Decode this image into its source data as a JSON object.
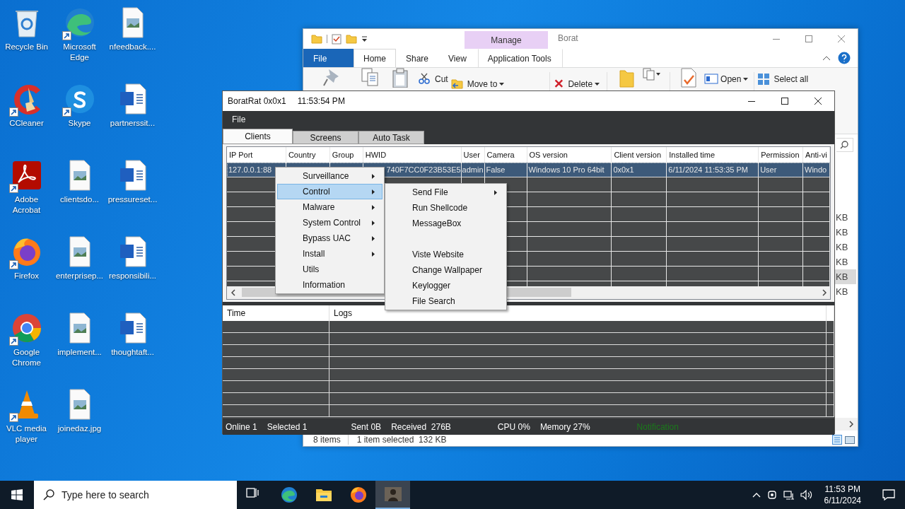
{
  "desktop": {
    "icons": [
      {
        "label": "Recycle Bin",
        "kind": "recycle",
        "shortcut": false
      },
      {
        "label": "CCleaner",
        "kind": "ccleaner",
        "shortcut": true
      },
      {
        "label": "Adobe Acrobat",
        "kind": "acrobat",
        "shortcut": true
      },
      {
        "label": "Firefox",
        "kind": "firefox",
        "shortcut": true
      },
      {
        "label": "Google Chrome",
        "kind": "chrome",
        "shortcut": true
      },
      {
        "label": "VLC media player",
        "kind": "vlc",
        "shortcut": true
      },
      {
        "label": "Microsoft Edge",
        "kind": "edge",
        "shortcut": true
      },
      {
        "label": "Skype",
        "kind": "skype",
        "shortcut": true
      },
      {
        "label": "clientsdo...",
        "kind": "image",
        "shortcut": false
      },
      {
        "label": "enterprisep...",
        "kind": "image",
        "shortcut": false
      },
      {
        "label": "implement...",
        "kind": "image",
        "shortcut": false
      },
      {
        "label": "joinedaz.jpg",
        "kind": "image",
        "shortcut": false
      },
      {
        "label": "nfeedback....",
        "kind": "image",
        "shortcut": false
      },
      {
        "label": "partnerssit...",
        "kind": "word",
        "shortcut": false
      },
      {
        "label": "pressureset...",
        "kind": "word",
        "shortcut": false
      },
      {
        "label": "responsibili...",
        "kind": "word",
        "shortcut": false
      },
      {
        "label": "thoughtaft...",
        "kind": "word",
        "shortcut": false
      }
    ]
  },
  "explorer": {
    "title": "Borat",
    "contextual_tab_group": "Manage",
    "tabs": [
      {
        "label": "File",
        "kind": "backstage",
        "selected": false
      },
      {
        "label": "Home",
        "kind": "tab",
        "selected": true
      },
      {
        "label": "Share",
        "kind": "tab",
        "selected": false
      },
      {
        "label": "View",
        "kind": "tab",
        "selected": false
      },
      {
        "label": "Application Tools",
        "kind": "contextual",
        "selected": false
      }
    ],
    "ribbon": [
      {
        "label": "Cut",
        "kind": "cut"
      },
      {
        "label": "Move to",
        "kind": "move"
      },
      {
        "label": "Delete",
        "kind": "delete"
      },
      {
        "label": "Open",
        "kind": "open"
      },
      {
        "label": "Select all",
        "kind": "select_all"
      }
    ],
    "sizes": [
      {
        "text": "KB",
        "selected": false
      },
      {
        "text": "KB",
        "selected": false
      },
      {
        "text": "KB",
        "selected": false
      },
      {
        "text": "KB",
        "selected": false
      },
      {
        "text": "KB",
        "selected": true
      },
      {
        "text": "KB",
        "selected": false
      }
    ],
    "status": [
      "8 items",
      "1 item selected  132 KB"
    ]
  },
  "borat": {
    "title": "BoratRat 0x0x1",
    "clock": "11:53:54 PM",
    "menu": [
      "File"
    ],
    "tabs": [
      {
        "label": "Clients",
        "selected": true
      },
      {
        "label": "Screens",
        "selected": false
      },
      {
        "label": "Auto Task",
        "selected": false
      }
    ],
    "clients": {
      "columns": [
        "IP Port",
        "Country",
        "Group",
        "HWID",
        "User",
        "Camera",
        "OS version",
        "Client version",
        "Installed time",
        "Permission",
        "Anti-vi"
      ],
      "rows": [
        {
          "ip_port": "127.0.0.1:88",
          "hwid": "740F7CC0F23B53E5",
          "user": "admin",
          "camera": "False",
          "os_version": "Windows 10 Pro 64bit",
          "client_version": "0x0x1",
          "installed_time": "6/11/2024 11:53:35 PM",
          "permission": "User",
          "anti_virus": "Windo",
          "selected": true
        }
      ]
    },
    "context_menu": [
      {
        "label": "Surveillance",
        "submenu": true,
        "selected": false
      },
      {
        "label": "Control",
        "submenu": true,
        "selected": true
      },
      {
        "label": "Malware",
        "submenu": true,
        "selected": false
      },
      {
        "label": "System Control",
        "submenu": true,
        "selected": false
      },
      {
        "label": "Bypass UAC",
        "submenu": true,
        "selected": false
      },
      {
        "label": "Install",
        "submenu": true,
        "selected": false
      },
      {
        "label": "Utils",
        "submenu": false,
        "selected": false
      },
      {
        "label": "Information",
        "submenu": false,
        "selected": false
      }
    ],
    "submenu": [
      {
        "kind": "item",
        "label": "Send File",
        "submenu": true
      },
      {
        "kind": "item",
        "label": "Run Shellcode",
        "submenu": false
      },
      {
        "kind": "item",
        "label": "MessageBox",
        "submenu": false
      },
      {
        "kind": "spacer"
      },
      {
        "kind": "item",
        "label": "Viste Website",
        "submenu": false
      },
      {
        "kind": "item",
        "label": "Change Wallpaper",
        "submenu": false
      },
      {
        "kind": "item",
        "label": "Keylogger",
        "submenu": false
      },
      {
        "kind": "item",
        "label": "File Search",
        "submenu": false
      }
    ],
    "logs": {
      "columns": [
        "Time",
        "Logs"
      ]
    },
    "status": [
      {
        "text": "Online 1",
        "color": "#ffffff"
      },
      {
        "text": "Selected 1",
        "color": "#ffffff"
      },
      {
        "text": "Sent 0B",
        "color": "#ffffff"
      },
      {
        "text": "Received  276B",
        "color": "#ffffff"
      },
      {
        "text": "CPU 0%",
        "color": "#ffffff"
      },
      {
        "text": "Memory 27%",
        "color": "#ffffff"
      },
      {
        "text": "Notification",
        "color": "#1a7a1a"
      }
    ]
  },
  "taskbar": {
    "search": {
      "placeholder": "Type here to search"
    },
    "apps": [
      {
        "kind": "taskview",
        "selected": false
      },
      {
        "kind": "edge",
        "selected": false
      },
      {
        "kind": "explorer",
        "selected": false
      },
      {
        "kind": "firefox",
        "selected": false
      },
      {
        "kind": "borat",
        "selected": true
      }
    ],
    "time": "11:53 PM",
    "date": "6/11/2024"
  }
}
